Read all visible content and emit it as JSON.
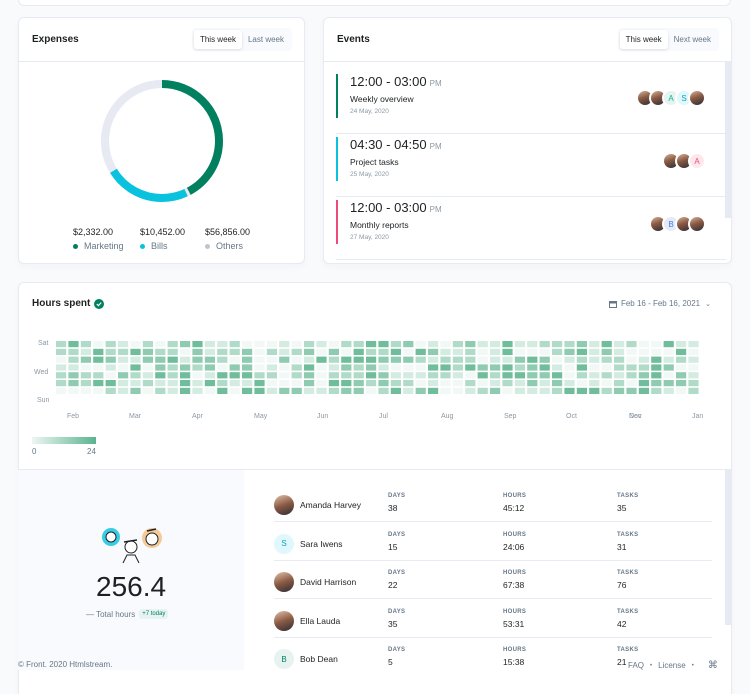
{
  "expenses": {
    "title": "Expenses",
    "tabs": [
      "This week",
      "Last week"
    ],
    "active_tab": 0,
    "legend": [
      {
        "value": "$2,332.00",
        "label": "Marketing",
        "color": "#00805f"
      },
      {
        "value": "$10,452.00",
        "label": "Bills",
        "color": "#09c2de"
      },
      {
        "value": "$56,856.00",
        "label": "Others",
        "color": "#e7eaf3"
      }
    ],
    "donut_share": [
      0.43,
      0.24,
      0.33
    ]
  },
  "events": {
    "title": "Events",
    "tabs": [
      "This week",
      "Next week"
    ],
    "active_tab": 0,
    "items": [
      {
        "time": "12:00 - 03:00",
        "ampm": "PM",
        "name": "Weekly overview",
        "date": "24 May, 2020",
        "color": "#00805f",
        "avatars": [
          "photo",
          "photo",
          "A",
          "S",
          "photo"
        ]
      },
      {
        "time": "04:30 - 04:50",
        "ampm": "PM",
        "name": "Project tasks",
        "date": "25 May, 2020",
        "color": "#09c2de",
        "avatars": [
          "photo",
          "photo",
          "A"
        ]
      },
      {
        "time": "12:00 - 03:00",
        "ampm": "PM",
        "name": "Monthly reports",
        "date": "27 May, 2020",
        "color": "#ed4c78",
        "avatars": [
          "photo",
          "B",
          "photo",
          "photo"
        ]
      }
    ]
  },
  "hours": {
    "title": "Hours spent",
    "date_range": "Feb 16 - Feb 16, 2021",
    "days": [
      "Sat",
      "Wed",
      "Sun"
    ],
    "months": [
      "Feb",
      "Mar",
      "Apr",
      "May",
      "Jun",
      "Jul",
      "Aug",
      "Sep",
      "Oct",
      "Nov",
      "Dec",
      "Jan"
    ],
    "scale_min": "0",
    "scale_max": "24"
  },
  "team": {
    "total": "256.4",
    "total_label": "— Total hours",
    "badge": "+7 today",
    "headers": {
      "days": "DAYS",
      "hours": "HOURS",
      "tasks": "TASKS"
    },
    "members": [
      {
        "name": "Amanda Harvey",
        "avatar": "photo",
        "days": "38",
        "hours": "45:12",
        "tasks": "35"
      },
      {
        "name": "Sara Iwens",
        "avatar": "S",
        "days": "15",
        "hours": "24:06",
        "tasks": "31"
      },
      {
        "name": "David Harrison",
        "avatar": "photo",
        "days": "22",
        "hours": "67:38",
        "tasks": "76"
      },
      {
        "name": "Ella Lauda",
        "avatar": "photo",
        "days": "35",
        "hours": "53:31",
        "tasks": "42"
      },
      {
        "name": "Bob Dean",
        "avatar": "B",
        "days": "5",
        "hours": "15:38",
        "tasks": "21"
      }
    ]
  },
  "footer": {
    "copyright": "© Front. 2020 Htmlstream.",
    "links": [
      "FAQ",
      "License"
    ],
    "shortcut_icon": "command-icon"
  }
}
